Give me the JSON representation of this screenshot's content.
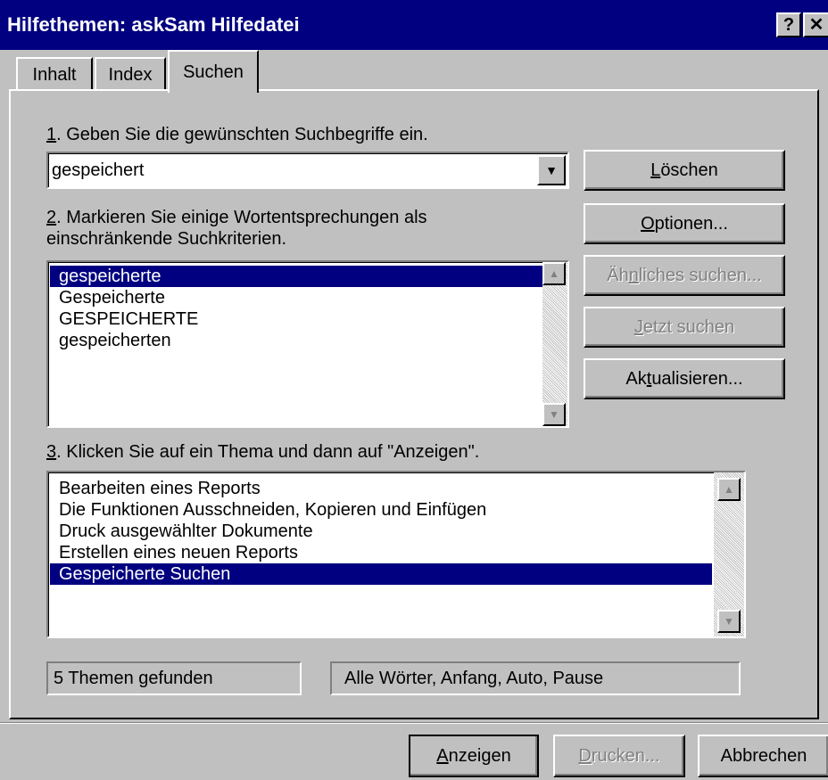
{
  "window": {
    "title": "Hilfethemen: askSam Hilfedatei",
    "help_glyph": "?",
    "close_glyph": "✕"
  },
  "tabs": [
    {
      "label": "Inhalt"
    },
    {
      "label": "Index"
    },
    {
      "label": "Suchen"
    }
  ],
  "step1": {
    "num": "1",
    "text": ". Geben Sie die gewünschten Suchbegriffe ein.",
    "search_value": "gespeichert"
  },
  "step2": {
    "num": "2",
    "text_line1": ". Markieren Sie einige Wortentsprechungen als",
    "text_line2": "einschränkende Suchkriterien.",
    "words": [
      {
        "label": "gespeicherte",
        "selected": true
      },
      {
        "label": "Gespeicherte",
        "selected": false
      },
      {
        "label": "GESPEICHERTE",
        "selected": false
      },
      {
        "label": "gespeicherten",
        "selected": false
      }
    ]
  },
  "step3": {
    "num": "3",
    "text": ". Klicken Sie auf ein Thema und dann auf \"Anzeigen\".",
    "topics": [
      {
        "label": "Bearbeiten eines Reports",
        "selected": false
      },
      {
        "label": "Die Funktionen Ausschneiden, Kopieren und Einfügen",
        "selected": false
      },
      {
        "label": "Druck ausgewählter Dokumente",
        "selected": false
      },
      {
        "label": "Erstellen eines neuen Reports",
        "selected": false
      },
      {
        "label": "Gespeicherte Suchen",
        "selected": true
      }
    ]
  },
  "side_buttons": {
    "clear": {
      "mn": "L",
      "rest": "öschen"
    },
    "options": {
      "mn": "O",
      "rest": "ptionen..."
    },
    "similar": {
      "pre": "Äh",
      "mn": "n",
      "rest": "liches suchen..."
    },
    "search_now": {
      "mn": "J",
      "rest": "etzt suchen"
    },
    "update": {
      "pre": "Ak",
      "mn": "t",
      "rest": "ualisieren..."
    }
  },
  "status": {
    "count": "5 Themen gefunden",
    "options": "Alle Wörter, Anfang, Auto, Pause"
  },
  "bottom_buttons": {
    "show": {
      "mn": "A",
      "rest": "nzeigen"
    },
    "print": {
      "mn": "D",
      "rest": "rucken..."
    },
    "cancel": "Abbrechen"
  },
  "icons": {
    "dropdown": "▼",
    "scroll_up": "▲",
    "scroll_down": "▼"
  }
}
